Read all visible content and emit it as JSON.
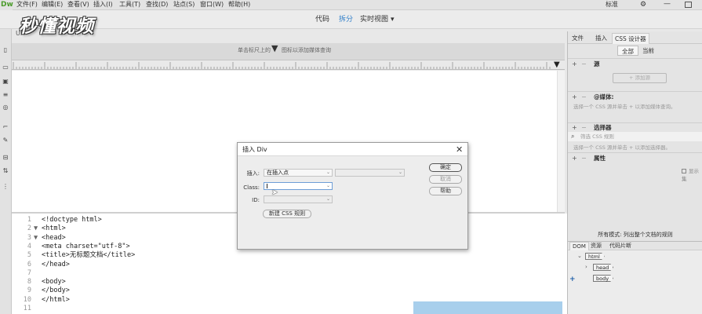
{
  "menubar": {
    "logo": "Dw",
    "items": [
      "文件(F)",
      "编辑(E)",
      "查看(V)",
      "插入(I)",
      "工具(T)",
      "查找(D)",
      "站点(S)",
      "窗口(W)",
      "帮助(H)"
    ],
    "workspace": "标准",
    "gear": "⚙",
    "minimize": "—"
  },
  "viewbar": {
    "code": "代码",
    "split": "拆分",
    "live": "实时视图",
    "live_dropdown": "▾",
    "active": "拆分"
  },
  "watermark": "秒懂视频",
  "doc_tab_fragment": "Ur",
  "media_query_bar": {
    "hint_left": "单击标尺上的",
    "hint_right": "图标以添加媒体查询",
    "marker": "▼"
  },
  "ruler": {
    "end_marker": "▼"
  },
  "code": {
    "lines": [
      {
        "num": "1",
        "fold": "",
        "text": "<!doctype html>"
      },
      {
        "num": "2",
        "fold": "▼",
        "text": "<html>"
      },
      {
        "num": "3",
        "fold": "▼",
        "text": "<head>"
      },
      {
        "num": "4",
        "fold": "",
        "text": "<meta charset=\"utf-8\">"
      },
      {
        "num": "5",
        "fold": "",
        "text": "<title>无标题文档</title>"
      },
      {
        "num": "6",
        "fold": "",
        "text": "</head>"
      },
      {
        "num": "7",
        "fold": "",
        "text": ""
      },
      {
        "num": "8",
        "fold": "",
        "text": "<body>"
      },
      {
        "num": "9",
        "fold": "",
        "text": "</body>"
      },
      {
        "num": "10",
        "fold": "",
        "text": "</html>"
      },
      {
        "num": "11",
        "fold": "",
        "text": ""
      }
    ]
  },
  "right_panel": {
    "tabs": [
      "文件",
      "插入",
      "CSS 设计器"
    ],
    "active_tab": "CSS 设计器",
    "sub_tabs": [
      "全部",
      "当前"
    ],
    "active_sub": "全部",
    "sources": {
      "title": "源",
      "add_button": "+ 添加源"
    },
    "media": {
      "title": "@媒体:",
      "desc": "选择一个 CSS 源并单击 + 以添加媒体查询。"
    },
    "selectors": {
      "title": "选择器",
      "filter_placeholder": "筛选 CSS 规则",
      "desc": "选择一个 CSS 源并单击 + 以添加选择器。"
    },
    "properties": {
      "title": "属性",
      "show_set": "显示集"
    },
    "mode_text": "所有模式: 列出整个文档的规则",
    "dom_tabs": [
      "DOM",
      "资源",
      "代码片断"
    ],
    "dom_active": "DOM",
    "dom_nodes": [
      "html",
      "head",
      "body"
    ]
  },
  "dialog": {
    "title": "插入 Div",
    "close": "✕",
    "insert_label": "插入:",
    "insert_value": "在插入点",
    "class_label": "Class:",
    "class_value": "",
    "id_label": "ID:",
    "id_value": "",
    "new_css_button": "新建 CSS 规则",
    "ok_button": "确定",
    "cancel_button": "取消",
    "help_button": "帮助"
  }
}
